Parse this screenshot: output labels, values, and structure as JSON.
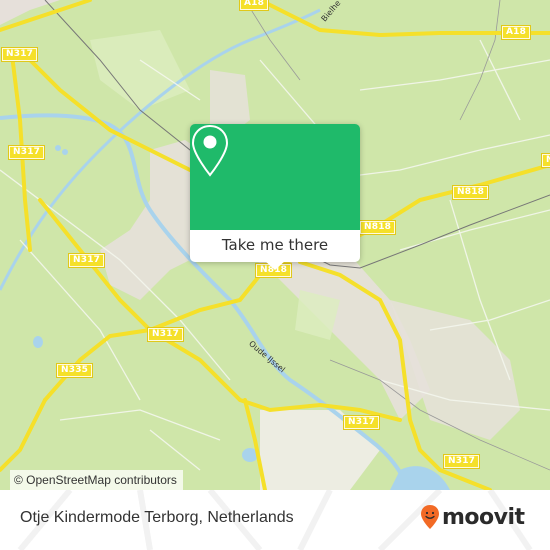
{
  "map": {
    "road_labels": [
      {
        "text": "N317",
        "name": "road-label-n317-topleft"
      },
      {
        "text": "A18",
        "name": "road-label-a18-top"
      },
      {
        "text": "A18",
        "name": "road-label-a18-right"
      },
      {
        "text": "N317",
        "name": "road-label-n317-left"
      },
      {
        "text": "N818",
        "name": "road-label-n818-right"
      },
      {
        "text": "N818",
        "name": "road-label-n818-center"
      },
      {
        "text": "N818",
        "name": "road-label-n818-center-south"
      },
      {
        "text": "N317",
        "name": "road-label-n317-west"
      },
      {
        "text": "N317",
        "name": "road-label-n317-southwest"
      },
      {
        "text": "N335",
        "name": "road-label-n335"
      },
      {
        "text": "N317",
        "name": "road-label-n317-south"
      },
      {
        "text": "N317",
        "name": "road-label-n317-southeast"
      },
      {
        "text": "N",
        "name": "road-label-n-edge"
      }
    ],
    "water_labels": {
      "oude_ijssel": "Oude IJssel"
    },
    "street_labels": {
      "bielheimerstraat": "Bielhe"
    },
    "attribution": "© OpenStreetMap contributors",
    "colors": {
      "land": "#cfe6a9",
      "urban": "#e8e2dc",
      "water": "#a9d3ec",
      "road": "#f5e02a",
      "popup": "#1fba6a"
    }
  },
  "popup": {
    "action_label": "Take me there",
    "icon": "location-pin-icon"
  },
  "footer": {
    "place_title": "Otje Kindermode Terborg, Netherlands",
    "brand": "moovit",
    "brand_color": "#f26a25"
  }
}
